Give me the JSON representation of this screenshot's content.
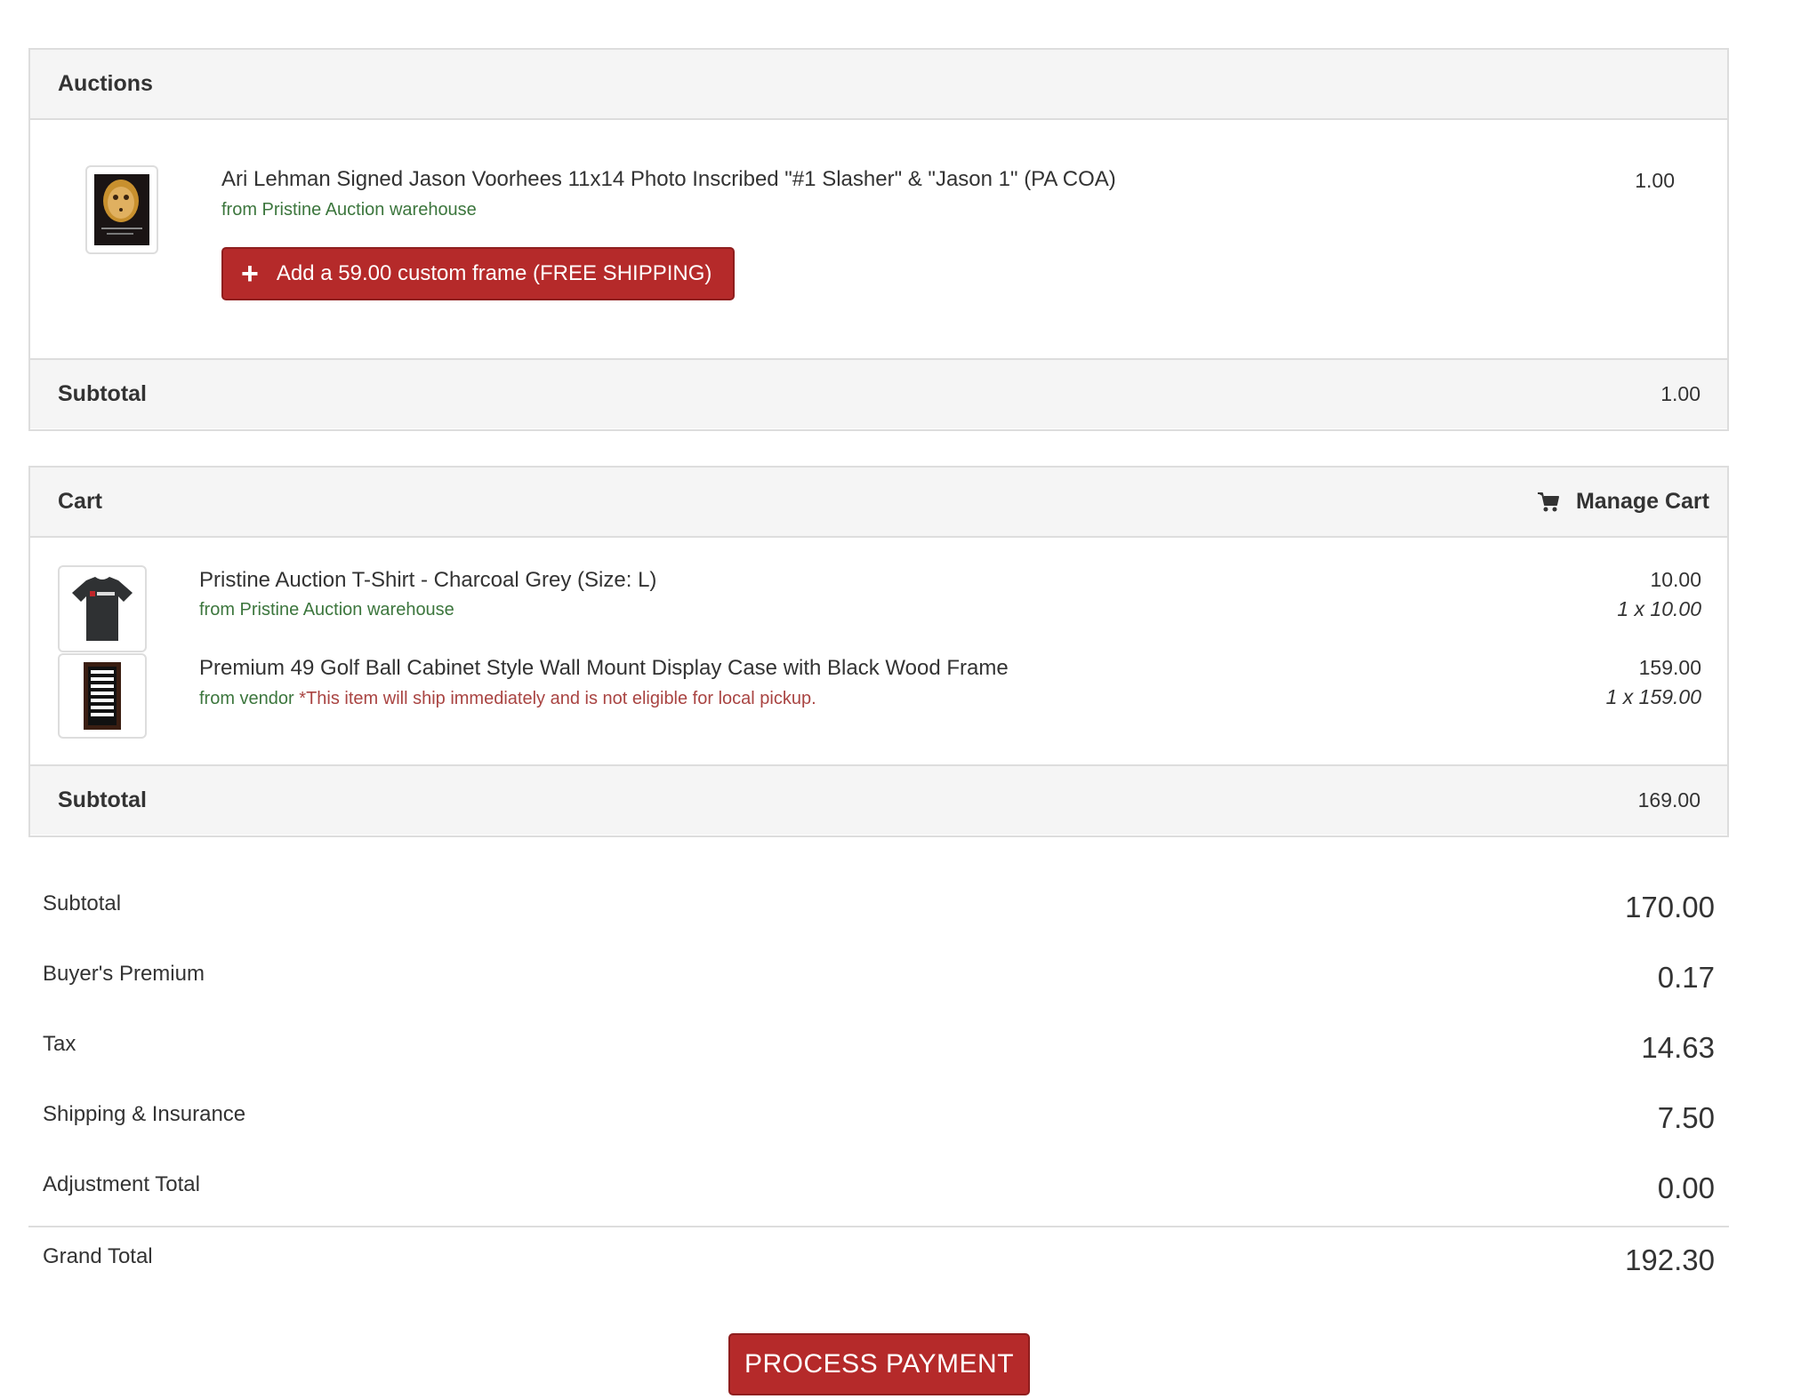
{
  "auctions": {
    "title": "Auctions",
    "items": [
      {
        "title": "Ari Lehman Signed Jason Voorhees 11x14 Photo Inscribed \"#1 Slasher\" & \"Jason 1\" (PA COA)",
        "from": "from Pristine Auction warehouse",
        "price": "1.00",
        "frame_button": "Add a 59.00 custom frame (FREE SHIPPING)",
        "frame_icon": "plus-icon"
      }
    ],
    "subtotal_label": "Subtotal",
    "subtotal_value": "1.00"
  },
  "cart": {
    "title": "Cart",
    "manage_label": "Manage Cart",
    "manage_icon": "cart-icon",
    "items": [
      {
        "title": "Pristine Auction T-Shirt - Charcoal Grey (Size: L)",
        "from": "from Pristine Auction warehouse",
        "note": "",
        "price": "10.00",
        "qty": "1 x 10.00"
      },
      {
        "title": "Premium 49 Golf Ball Cabinet Style Wall Mount Display Case with Black Wood Frame",
        "from": "from vendor",
        "note": "*This item will ship immediately and is not eligible for local pickup.",
        "price": "159.00",
        "qty": "1 x 159.00"
      }
    ],
    "subtotal_label": "Subtotal",
    "subtotal_value": "169.00"
  },
  "summary": {
    "rows": [
      {
        "label": "Subtotal",
        "value": "170.00"
      },
      {
        "label": "Buyer's Premium",
        "value": "0.17"
      },
      {
        "label": "Tax",
        "value": "14.63"
      },
      {
        "label": "Shipping & Insurance",
        "value": "7.50"
      },
      {
        "label": "Adjustment Total",
        "value": "0.00"
      }
    ],
    "grand_total_label": "Grand Total",
    "grand_total_value": "192.30"
  },
  "process_button": "PROCESS PAYMENT",
  "colors": {
    "brand_red": "#b52a2a",
    "success_green": "#3c763d",
    "warning_red": "#a94442"
  }
}
